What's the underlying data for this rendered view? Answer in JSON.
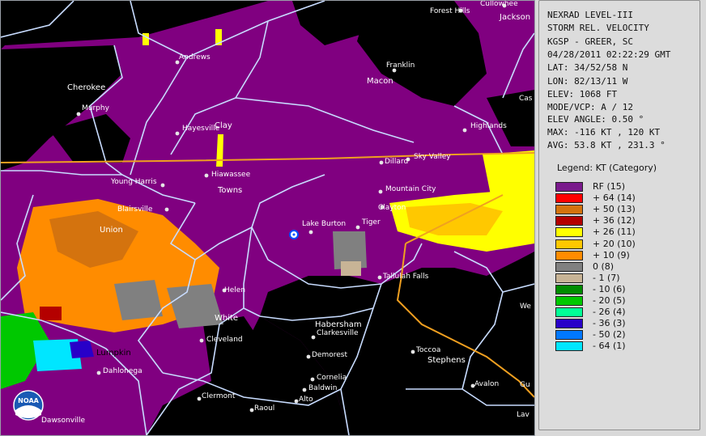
{
  "info": {
    "lines_top": [
      "NEXRAD LEVEL-III",
      "STORM REL. VELOCITY",
      "KGSP - GREER, SC",
      "04/28/2011 02:22:29 GMT",
      "LAT: 34/52/58 N",
      "LON: 82/13/11 W",
      "ELEV: 1068 FT",
      "MODE/VCP: A / 12"
    ],
    "lines_stats": [
      "ELEV ANGLE: 0.50 °",
      "MAX: -116 KT , 120 KT",
      "AVG: 53.8 KT , 231.3 °"
    ]
  },
  "legend": {
    "title": "Legend: KT (Category)",
    "items": [
      {
        "label": "RF  (15)",
        "color": "#7a1a8c"
      },
      {
        "label": "+ 64  (14)",
        "color": "#ff0000"
      },
      {
        "label": "+ 50  (13)",
        "color": "#d4730e"
      },
      {
        "label": "+ 36  (12)",
        "color": "#b40000"
      },
      {
        "label": "+ 26  (11)",
        "color": "#ffff00"
      },
      {
        "label": "+ 20  (10)",
        "color": "#ffc800"
      },
      {
        "label": "+ 10  (9)",
        "color": "#ff8c00"
      },
      {
        "label": "0  (8)",
        "color": "#808080"
      },
      {
        "label": "- 1  (7)",
        "color": "#c8b496"
      },
      {
        "label": "- 10  (6)",
        "color": "#008c00"
      },
      {
        "label": "- 20  (5)",
        "color": "#00c800"
      },
      {
        "label": "- 26  (4)",
        "color": "#00ff96"
      },
      {
        "label": "- 36  (3)",
        "color": "#2800c8"
      },
      {
        "label": "- 50  (2)",
        "color": "#0078ff"
      },
      {
        "label": "- 64  (1)",
        "color": "#00e6ff"
      }
    ]
  },
  "map": {
    "colors": {
      "background": "#000000",
      "rf": "#800080",
      "county_line": "#c8dcff",
      "highway": "#f0a020",
      "city_dot": "#e6e6e6"
    },
    "places": [
      {
        "name": "Forest Hills",
        "kind": "town"
      },
      {
        "name": "Cullowhee",
        "kind": "town"
      },
      {
        "name": "Jackson",
        "kind": "county"
      },
      {
        "name": "Andrews",
        "kind": "town"
      },
      {
        "name": "Franklin",
        "kind": "town"
      },
      {
        "name": "Cherokee",
        "kind": "county"
      },
      {
        "name": "Macon",
        "kind": "county"
      },
      {
        "name": "Murphy",
        "kind": "town"
      },
      {
        "name": "Clay",
        "kind": "county"
      },
      {
        "name": "Hayesville",
        "kind": "town"
      },
      {
        "name": "Highlands",
        "kind": "town"
      },
      {
        "name": "Cas",
        "kind": "town"
      },
      {
        "name": "Sky Valley",
        "kind": "town"
      },
      {
        "name": "Dillard",
        "kind": "town"
      },
      {
        "name": "Hiawassee",
        "kind": "town"
      },
      {
        "name": "Young Harris",
        "kind": "town"
      },
      {
        "name": "Towns",
        "kind": "county"
      },
      {
        "name": "Mountain City",
        "kind": "town"
      },
      {
        "name": "Blairsville",
        "kind": "town"
      },
      {
        "name": "Clayton",
        "kind": "town"
      },
      {
        "name": "Union",
        "kind": "county"
      },
      {
        "name": "Lake Burton",
        "kind": "town"
      },
      {
        "name": "Tiger",
        "kind": "town"
      },
      {
        "name": "Tallulah Falls",
        "kind": "town"
      },
      {
        "name": "Helen",
        "kind": "town"
      },
      {
        "name": "White",
        "kind": "county"
      },
      {
        "name": "We",
        "kind": "town"
      },
      {
        "name": "Habersham",
        "kind": "county"
      },
      {
        "name": "Clarkesville",
        "kind": "town"
      },
      {
        "name": "Cleveland",
        "kind": "town"
      },
      {
        "name": "Toccoa",
        "kind": "town"
      },
      {
        "name": "Lumpkin",
        "kind": "county-dark"
      },
      {
        "name": "Stephens",
        "kind": "county"
      },
      {
        "name": "Demorest",
        "kind": "town"
      },
      {
        "name": "Dahlonega",
        "kind": "town"
      },
      {
        "name": "Cornelia",
        "kind": "town"
      },
      {
        "name": "Baldwin",
        "kind": "town"
      },
      {
        "name": "Avalon",
        "kind": "town"
      },
      {
        "name": "Gu",
        "kind": "town"
      },
      {
        "name": "Clermont",
        "kind": "town"
      },
      {
        "name": "Alto",
        "kind": "town"
      },
      {
        "name": "Raoul",
        "kind": "town"
      },
      {
        "name": "Dawsonville",
        "kind": "town"
      },
      {
        "name": "Lav",
        "kind": "town"
      }
    ],
    "logo_text": "NOAA"
  }
}
